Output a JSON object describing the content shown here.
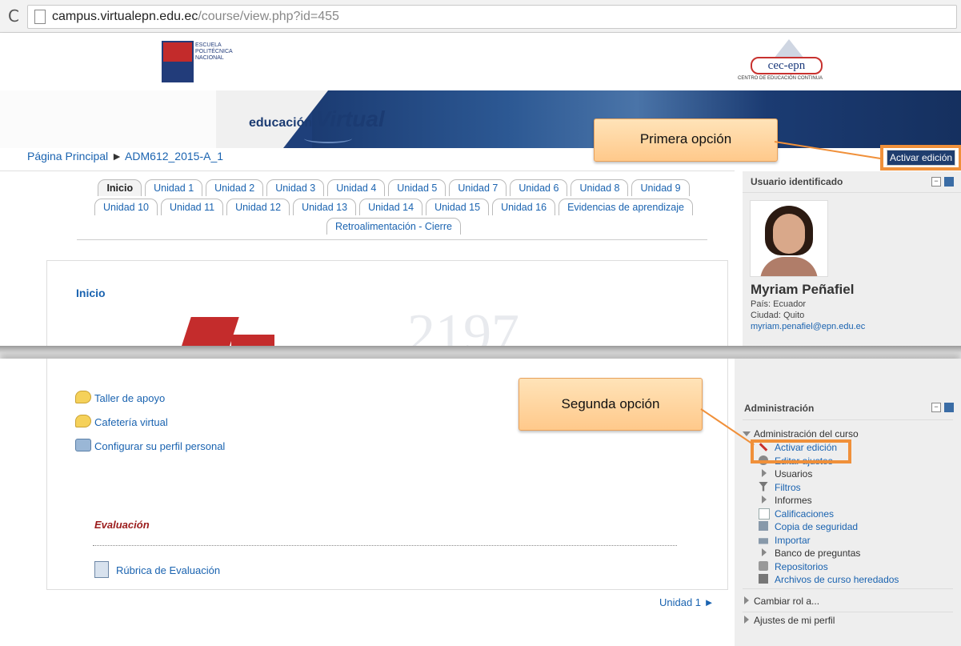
{
  "browser": {
    "reload_icon": "reload-icon",
    "url_host": "campus.virtualepn.edu.ec",
    "url_path": "/course/view.php?id=455"
  },
  "header": {
    "epn_name": "ESCUELA POLITÉCNICA NACIONAL",
    "cec_logo": "cec-epn",
    "cec_sub": "CENTRO DE EDUCACIÓN CONTINUA",
    "banner_prefix": "educación",
    "banner_word": "Virtual"
  },
  "breadcrumb": {
    "home": "Página Principal",
    "separator": "►",
    "course": "ADM612_2015-A_1"
  },
  "edit_button_label": "Activar edición",
  "tabs": {
    "row1": [
      "Inicio",
      "Unidad 1",
      "Unidad 2",
      "Unidad 3",
      "Unidad 4",
      "Unidad 5",
      "Unidad 7",
      "Unidad 6",
      "Unidad 8",
      "Unidad 9"
    ],
    "row2": [
      "Unidad 10",
      "Unidad 11",
      "Unidad 12",
      "Unidad 13",
      "Unidad 14",
      "Unidad 15",
      "Unidad 16",
      "Evidencias de aprendizaje"
    ],
    "row3": [
      "Retroalimentación - Cierre"
    ]
  },
  "main": {
    "section_title": "Inicio",
    "activities": [
      "Taller de apoyo",
      "Cafetería virtual",
      "Configurar su perfil personal"
    ],
    "evaluation_title": "Evaluación",
    "rubric": "Rúbrica de Evaluación",
    "next_unit": "Unidad 1 ►"
  },
  "user_block": {
    "title": "Usuario identificado",
    "name": "Myriam Peñafiel",
    "country": "País: Ecuador",
    "city": "Ciudad: Quito",
    "email": "myriam.penafiel@epn.edu.ec"
  },
  "callouts": {
    "first": "Primera opción",
    "second": "Segunda opción"
  },
  "admin": {
    "title": "Administración",
    "course_admin": "Administración del curso",
    "items": [
      {
        "label": "Activar edición",
        "icon": "edit-tools-icon",
        "link": true
      },
      {
        "label": "Editar ajustes",
        "icon": "settings-icon",
        "link": true
      },
      {
        "label": "Usuarios",
        "icon": "expand-icon",
        "link": false
      },
      {
        "label": "Filtros",
        "icon": "filter-icon",
        "link": true
      },
      {
        "label": "Informes",
        "icon": "expand-icon",
        "link": false
      },
      {
        "label": "Calificaciones",
        "icon": "grades-icon",
        "link": true
      },
      {
        "label": "Copia de seguridad",
        "icon": "backup-icon",
        "link": true
      },
      {
        "label": "Importar",
        "icon": "import-icon",
        "link": true
      },
      {
        "label": "Banco de preguntas",
        "icon": "expand-icon",
        "link": false
      },
      {
        "label": "Repositorios",
        "icon": "repository-icon",
        "link": true
      },
      {
        "label": "Archivos de curso heredados",
        "icon": "folder-icon",
        "link": true
      }
    ],
    "switch_role": "Cambiar rol a...",
    "profile_settings": "Ajustes de mi perfil"
  },
  "colors": {
    "accent_orange": "#f0903a",
    "link_blue": "#1a63b0",
    "banner_navy": "#1b3b72",
    "eval_red": "#9b1c1c"
  }
}
